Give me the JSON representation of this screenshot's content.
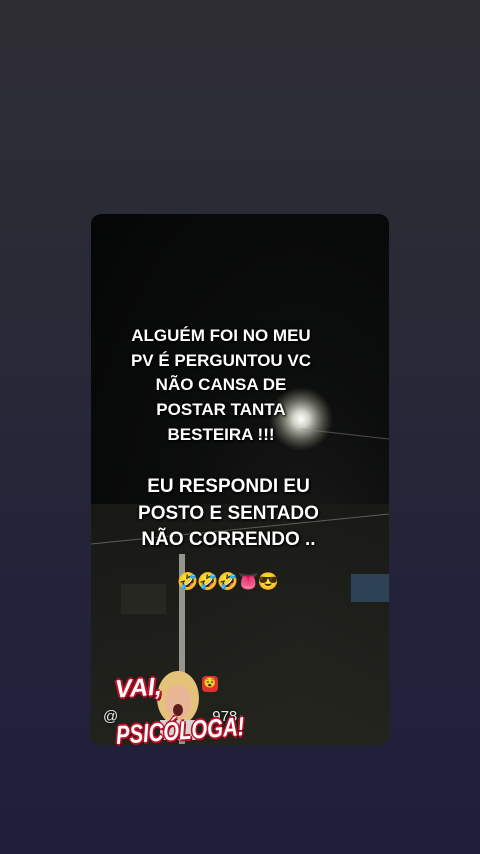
{
  "video": {
    "caption_main": "ALGUÉM FOI NO MEU PV É PERGUNTOU VC NÃO CANSA DE POSTAR TANTA BESTEIRA !!!",
    "caption_reply": "EU RESPONDI EU POSTO E SENTADO NÃO CORRENDO ..",
    "emojis": "🤣🤣🤣👅😎",
    "handle": "@",
    "handle_suffix": "978"
  },
  "sticker": {
    "line1": "VAI,",
    "line2": "PSICÓLOGA!",
    "badge": "😵"
  },
  "colors": {
    "background": "#25253a",
    "text": "#ffffff",
    "sticker_outline": "#c0102a"
  }
}
